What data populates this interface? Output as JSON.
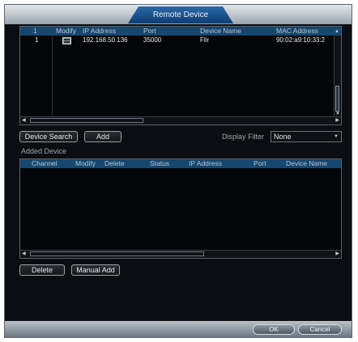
{
  "window": {
    "title": "Remote Device"
  },
  "search_table": {
    "columns": [
      "1",
      "Modify",
      "IP Address",
      "Port",
      "Device Name",
      "MAC Address"
    ],
    "rows": [
      {
        "num": "1",
        "ip": "192.168.50.136",
        "port": "35000",
        "name": "Flir",
        "mac": "90:02:a9:10:33:2"
      }
    ]
  },
  "toolbar": {
    "device_search_label": "Device Search",
    "add_label": "Add",
    "display_filter_label": "Display Filter",
    "display_filter_value": "None"
  },
  "added_device": {
    "section_label": "Added Device",
    "columns": [
      "Channel",
      "Modify",
      "Delete",
      "Status",
      "IP Address",
      "Port",
      "Device Name"
    ]
  },
  "actions": {
    "delete_label": "Delete",
    "manual_add_label": "Manual Add"
  },
  "footer": {
    "ok_label": "OK",
    "cancel_label": "Cancel"
  }
}
